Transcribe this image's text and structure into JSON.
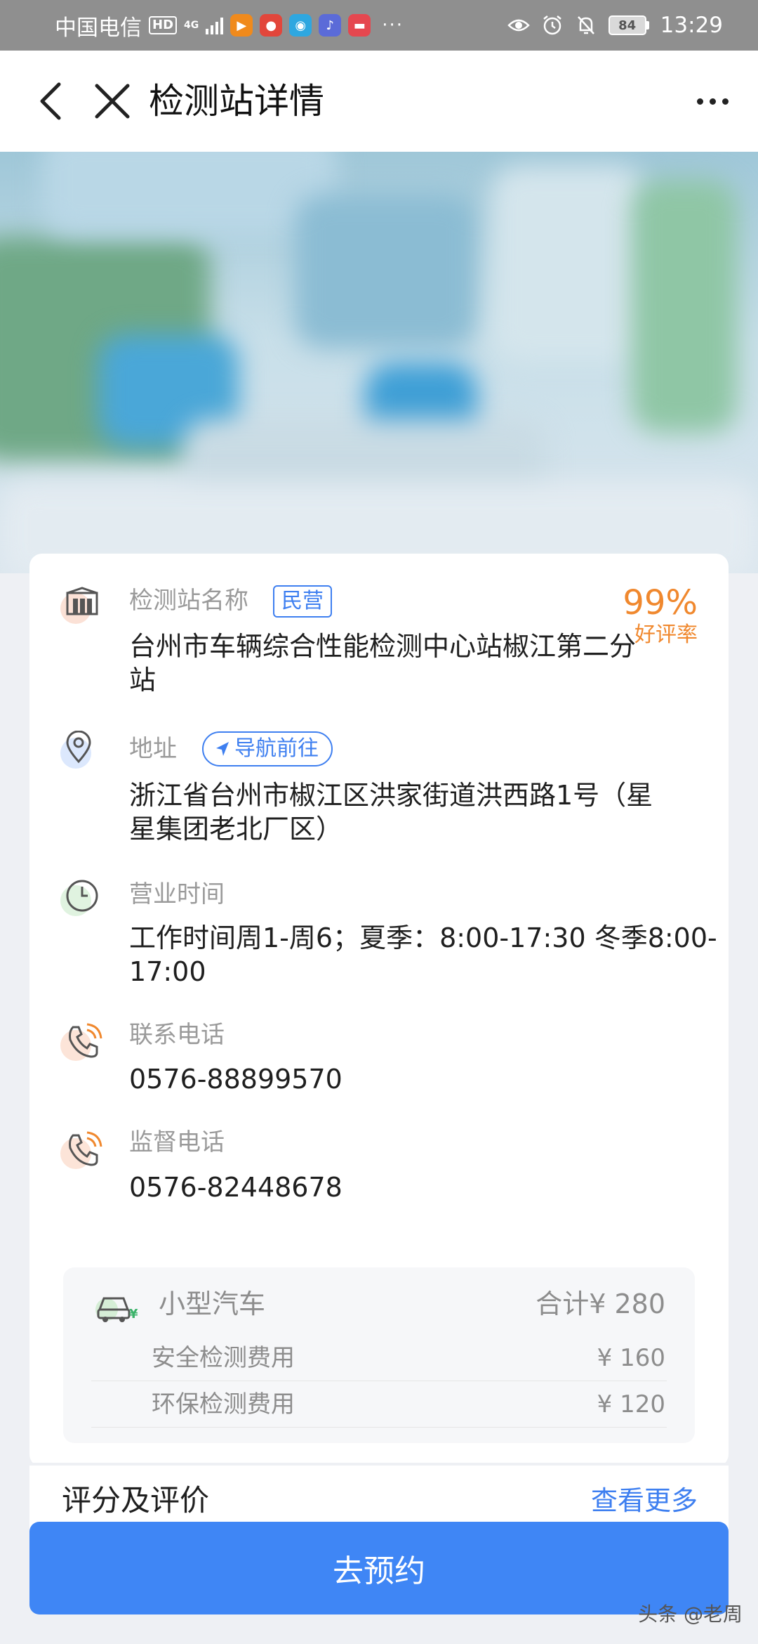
{
  "status_bar": {
    "carrier": "中国电信",
    "hd": "HD",
    "network": "4G",
    "more_dots": "···",
    "battery": "84",
    "time": "13:29"
  },
  "header": {
    "title": "检测站详情"
  },
  "station": {
    "name_label": "检测站名称",
    "ownership_tag": "民营",
    "name": "台州市车辆综合性能检测中心站椒江第二分站",
    "rating_percent": "99%",
    "rating_label": "好评率",
    "address_label": "地址",
    "navigate_label": "导航前往",
    "address": "浙江省台州市椒江区洪家街道洪西路1号（星星集团老北厂区）",
    "hours_label": "营业时间",
    "hours": "工作时间周1-周6；夏季：8:00-17:30 冬季8:00-17:00",
    "contact_label": "联系电话",
    "contact_phone": "0576-88899570",
    "supervision_label": "监督电话",
    "supervision_phone": "0576-82448678"
  },
  "fees": {
    "vehicle_type": "小型汽车",
    "total": "合计¥ 280",
    "items": [
      {
        "name": "安全检测费用",
        "price": "¥ 160"
      },
      {
        "name": "环保检测费用",
        "price": "¥ 120"
      }
    ]
  },
  "reviews": {
    "title": "评分及评价",
    "more": "查看更多"
  },
  "actions": {
    "book": "去预约"
  },
  "watermark": "头条 @老周",
  "colors": {
    "accent": "#3f86f5",
    "rating": "#f0882e",
    "label_gray": "#9a9a9a"
  }
}
